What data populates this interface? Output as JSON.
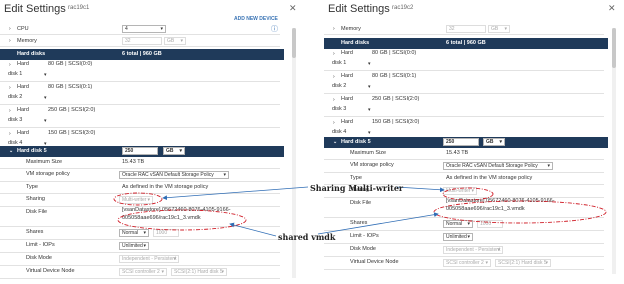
{
  "left": {
    "title": "Edit Settings",
    "vm": "rac19c1",
    "add_device": "ADD NEW DEVICE",
    "cpu": {
      "label": "CPU",
      "value": "4"
    },
    "memory": {
      "label": "Memory",
      "value": "32",
      "unit": "GB"
    },
    "hard_disks": {
      "label": "Hard disks",
      "value": "6 total | 960 GB"
    },
    "disks": [
      {
        "name": "Hard disk 1",
        "value": "80 GB | SCSI(0:0)"
      },
      {
        "name": "Hard disk 2",
        "value": "80 GB | SCSI(0:1)"
      },
      {
        "name": "Hard disk 3",
        "value": "250 GB | SCSI(2:0)"
      },
      {
        "name": "Hard disk 4",
        "value": "150 GB | SCSI(3:0)"
      }
    ],
    "disk5": {
      "label": "Hard disk 5",
      "size": "250",
      "unit": "GB"
    },
    "fields": {
      "max_size": {
        "label": "Maximum Size",
        "value": "15.43 TB"
      },
      "policy": {
        "label": "VM storage policy",
        "value": "Oracle RAC vSAN Default Storage Policy"
      },
      "type": {
        "label": "Type",
        "value": "As defined in the VM storage policy"
      },
      "sharing": {
        "label": "Sharing",
        "value": "Multi-writer"
      },
      "disk_file": {
        "label": "Disk File",
        "value1": "[vsanDatastore] 05672460-8076-4105-9166-",
        "value2": "005058aae696/rac19c1_3.vmdk"
      },
      "shares": {
        "label": "Shares",
        "value": "Normal",
        "num": "1000"
      },
      "limit": {
        "label": "Limit - IOPs",
        "value": "Unlimited"
      },
      "mode": {
        "label": "Disk Mode",
        "value": "Independent - Persistent"
      },
      "vdn": {
        "label": "Virtual Device Node",
        "ctrl": "SCSI controller 2",
        "node": "SCSI(2:1) Hard disk 5"
      }
    }
  },
  "right": {
    "title": "Edit Settings",
    "vm": "rac19c2",
    "memory": {
      "label": "Memory",
      "value": "32",
      "unit": "GB"
    },
    "hard_disks": {
      "label": "Hard disks",
      "value": "6 total | 960 GB"
    },
    "disks": [
      {
        "name": "Hard disk 1",
        "value": "80 GB | SCSI(0:0)"
      },
      {
        "name": "Hard disk 2",
        "value": "80 GB | SCSI(0:1)"
      },
      {
        "name": "Hard disk 3",
        "value": "250 GB | SCSI(2:0)"
      },
      {
        "name": "Hard disk 4",
        "value": "150 GB | SCSI(3:0)"
      }
    ],
    "disk5": {
      "label": "Hard disk 5",
      "size": "250",
      "unit": "GB"
    },
    "fields": {
      "max_size": {
        "label": "Maximum Size",
        "value": "15.43 TB"
      },
      "policy": {
        "label": "VM storage policy",
        "value": "Oracle RAC vSAN Default Storage Policy"
      },
      "type": {
        "label": "Type",
        "value": "As defined in the VM storage policy"
      },
      "sharing": {
        "label": "Sharing",
        "value": "Multi-writer"
      },
      "disk_file": {
        "label": "Disk File",
        "value1": "[vsanDatastore] 05672460-8076-4105-9166-",
        "value2": "005058aae696/rac19c1_3.vmdk"
      },
      "shares": {
        "label": "Shares",
        "value": "Normal",
        "num": "1000"
      },
      "limit": {
        "label": "Limit - IOPs",
        "value": "Unlimited"
      },
      "mode": {
        "label": "Disk Mode",
        "value": "Independent - Persistent"
      },
      "vdn": {
        "label": "Virtual Device Node",
        "ctrl": "SCSI controller 2",
        "node": "SCSI(2:1) Hard disk 5"
      }
    }
  },
  "annotations": {
    "sharing": "Sharing Multi-writer",
    "vmdk": "shared vmdk"
  },
  "colors": {
    "header_bar": "#1f3a5a",
    "annotation_red": "#d0202a",
    "arrow_blue": "#2f6db5"
  },
  "icons": {
    "expand": "chevron-right-icon",
    "collapse": "chevron-down-icon",
    "close": "close-icon",
    "info": "info-icon"
  }
}
